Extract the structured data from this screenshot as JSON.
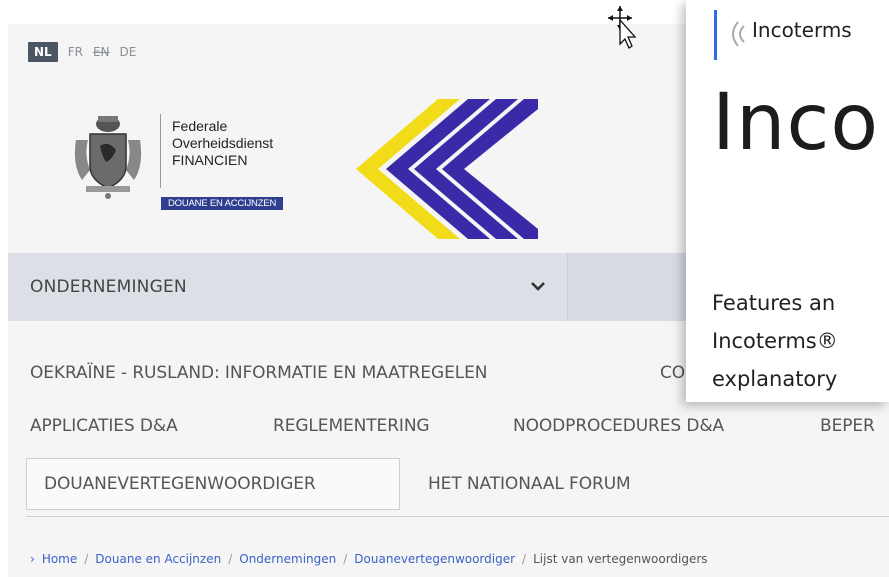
{
  "languages": [
    {
      "code": "NL",
      "active": true
    },
    {
      "code": "FR",
      "active": false
    },
    {
      "code": "EN",
      "active": false,
      "strikethrough": true
    },
    {
      "code": "DE",
      "active": false
    }
  ],
  "logo": {
    "line1": "Federale",
    "line2": "Overheidsdienst",
    "line3": "FINANCIEN",
    "badge": "DOUANE EN ACCIJNZEN",
    "crest_icon": "belgian-coat-of-arms-icon",
    "chevron_colors": [
      "#f2dc1a",
      "#3b2aa8"
    ]
  },
  "nav": {
    "select_label": "ONDERNEMINGEN",
    "chevron_icon": "chevron-down-icon"
  },
  "menu": {
    "row1": [
      "OEKRAÏNE - RUSLAND: INFORMATIE EN MAATREGELEN",
      "CO"
    ],
    "row2": [
      "APPLICATIES D&A",
      "REGLEMENTERING",
      "NOODPROCEDURES D&A",
      "BEPER"
    ],
    "row3": [
      "DOUANEVERTEGENWOORDIGER",
      "HET NATIONAAL FORUM"
    ]
  },
  "breadcrumb": {
    "items": [
      "Home",
      "Douane en Accijnzen",
      "Ondernemingen",
      "Douanevertegenwoordiger"
    ],
    "current": "Lijst van vertegenwoordigers",
    "separator": "/"
  },
  "popup": {
    "brand": "Incoterms",
    "title": "Inco",
    "desc_line1": "Features an",
    "desc_line2": "Incoterms®",
    "desc_line3": "explanatory",
    "accent_color": "#2e6be6"
  }
}
